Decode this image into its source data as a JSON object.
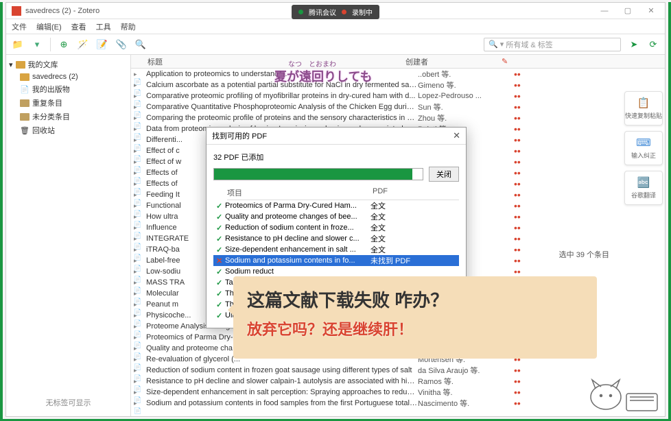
{
  "window": {
    "title": "savedrecs (2) - Zotero"
  },
  "menubar": [
    "文件",
    "编辑(E)",
    "查看",
    "工具",
    "帮助"
  ],
  "search": {
    "placeholder": "所有域 & 标签"
  },
  "sidebar": {
    "root": "我的文库",
    "items": [
      "savedrecs (2)",
      "我的出版物",
      "重复条目",
      "未分类条目",
      "回收站"
    ],
    "footer": "无标签可显示"
  },
  "columns": {
    "title": "标题",
    "creator": "创建者"
  },
  "rows": [
    {
      "t": "Application to proteomics to understand ...",
      "c": "..obert 等."
    },
    {
      "t": "Calcium ascorbate as a potential partial substitute for NaCl in dry fermented sau...",
      "c": "Gimeno 等."
    },
    {
      "t": "Comparative proteomic profiling of myofibrillar proteins in dry-cured ham with d...",
      "c": "Lopez-Pedrouso ..."
    },
    {
      "t": "Comparative Quantitative Phosphoproteomic Analysis of the Chicken Egg during...",
      "c": "Sun 等."
    },
    {
      "t": "Comparing the proteomic profile of proteins and the sensory characteristics in Ji...",
      "c": "Zhou 等."
    },
    {
      "t": "Data from proteomic analysis of bovine Longissimus dorsi muscle associated with",
      "c": "Poleti 等."
    },
    {
      "t": "Differenti...",
      "c": ""
    },
    {
      "t": "Effect of c",
      "c": ""
    },
    {
      "t": "Effect of w",
      "c": ""
    },
    {
      "t": "Effects of",
      "c": ""
    },
    {
      "t": "Effects of",
      "c": ""
    },
    {
      "t": "Feeding It",
      "c": ""
    },
    {
      "t": "Functional",
      "c": ""
    },
    {
      "t": "How ultra",
      "c": ""
    },
    {
      "t": "Influence",
      "c": ""
    },
    {
      "t": "INTEGRATE",
      "c": ""
    },
    {
      "t": "iTRAQ-ba",
      "c": ""
    },
    {
      "t": "Label-free",
      "c": ""
    },
    {
      "t": "Low-sodiu",
      "c": ""
    },
    {
      "t": "MASS TRA",
      "c": ""
    },
    {
      "t": "Molecular",
      "c": ""
    },
    {
      "t": "Peanut m",
      "c": ""
    },
    {
      "t": "Physicoche...",
      "c": ""
    },
    {
      "t": "Proteome Analysis Using Isoban...",
      "c": ""
    },
    {
      "t": "Proteomics of Parma Dry-C",
      "c": ""
    },
    {
      "t": "Quality and proteome cha...",
      "c": ""
    },
    {
      "t": "Re-evaluation of glycerol (...",
      "c": "Mortensen 等."
    },
    {
      "t": "Reduction of sodium content in frozen goat sausage using different types of salt",
      "c": "da Silva Araujo 等."
    },
    {
      "t": "Resistance to pH decline and slower calpain-1 autolysis are associated with high...",
      "c": "Ramos 等."
    },
    {
      "t": "Size-dependent enhancement in salt perception: Spraying approaches to reduce ...",
      "c": "Vinitha 等."
    },
    {
      "t": "Sodium and potassium contents in food samples from the first Portuguese total ...",
      "c": "Nascimento 等."
    }
  ],
  "dialog": {
    "title": "找到可用的 PDF",
    "msg": "32 PDF 已添加",
    "close_btn": "关闭",
    "th_item": "项目",
    "th_pdf": "PDF",
    "rows": [
      {
        "ok": true,
        "name": "Proteomics of Parma Dry-Cured Ham...",
        "pdf": "全文"
      },
      {
        "ok": true,
        "name": "Quality and proteome changes of bee...",
        "pdf": "全文"
      },
      {
        "ok": true,
        "name": "Reduction of sodium content in froze...",
        "pdf": "全文"
      },
      {
        "ok": true,
        "name": "Resistance to pH decline and slower c...",
        "pdf": "全文"
      },
      {
        "ok": true,
        "name": "Size-dependent enhancement in salt ...",
        "pdf": "全文"
      },
      {
        "ok": false,
        "name": "Sodium and potassium contents in fo...",
        "pdf": "未找到 PDF"
      },
      {
        "ok": true,
        "name": "Sodium reduct",
        "pdf": ""
      },
      {
        "ok": true,
        "name": "Tandem m",
        "pdf": ""
      },
      {
        "ok": true,
        "name": "The Ma",
        "pdf": ""
      },
      {
        "ok": true,
        "name": "The p omi",
        "pdf": ""
      },
      {
        "ok": true,
        "name": "Ultraso",
        "pdf": ""
      }
    ]
  },
  "right_tools": [
    "快速复制粘贴",
    "输入纠正",
    "谷歌翻译"
  ],
  "overlay": {
    "small": "なつ　とおまわ",
    "big": "夏が遠回りしても",
    "speech1": "这篇文献下载失败 咋办？",
    "speech2": "放弃它吗？还是继续肝！",
    "selected": "选中 39 个条目"
  },
  "top_pill": {
    "a": "腾讯会议",
    "b": "录制中"
  }
}
